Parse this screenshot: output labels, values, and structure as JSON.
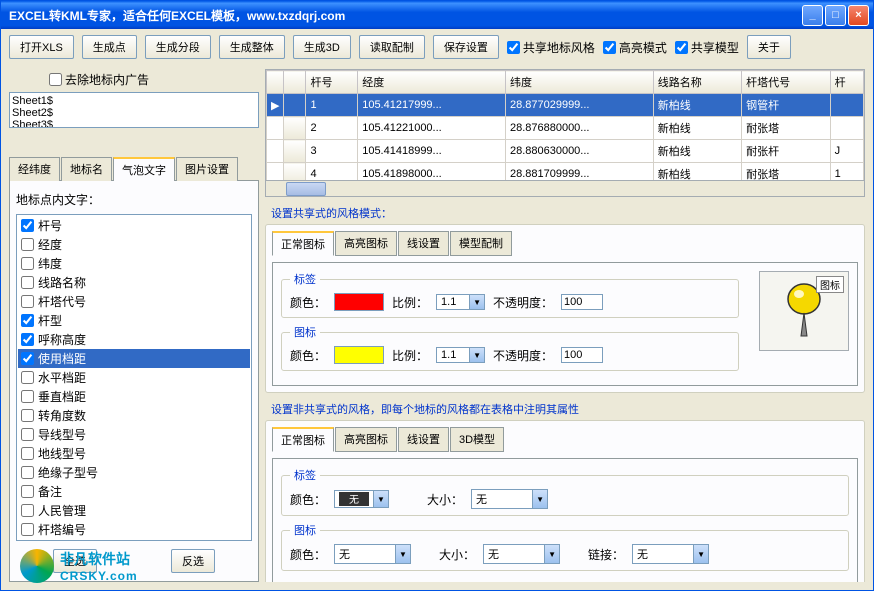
{
  "title": "EXCEL转KML专家，适合任何EXCEL模板，www.txzdqrj.com",
  "toolbar": {
    "open_xls": "打开XLS",
    "gen_points": "生成点",
    "gen_segments": "生成分段",
    "gen_whole": "生成整体",
    "gen_3d": "生成3D",
    "read_config": "读取配制",
    "save_settings": "保存设置",
    "share_landmark": "共享地标风格",
    "highlight_mode": "高亮模式",
    "share_model": "共享模型",
    "about": "关于"
  },
  "left": {
    "remove_ad": "去除地标内广告",
    "sheets": [
      "Sheet1$",
      "Sheet2$",
      "Sheet3$"
    ],
    "tabs": [
      "经纬度",
      "地标名",
      "气泡文字",
      "图片设置"
    ],
    "active_tab": 2,
    "point_text_label": "地标点内文字：",
    "checks": [
      {
        "label": "杆号",
        "checked": true
      },
      {
        "label": "经度",
        "checked": false
      },
      {
        "label": "纬度",
        "checked": false
      },
      {
        "label": "线路名称",
        "checked": false
      },
      {
        "label": "杆塔代号",
        "checked": false
      },
      {
        "label": "杆型",
        "checked": true
      },
      {
        "label": "呼称高度",
        "checked": true
      },
      {
        "label": "使用档距",
        "checked": true,
        "selected": true
      },
      {
        "label": "水平档距",
        "checked": false
      },
      {
        "label": "垂直档距",
        "checked": false
      },
      {
        "label": "转角度数",
        "checked": false
      },
      {
        "label": "导线型号",
        "checked": false
      },
      {
        "label": "地线型号",
        "checked": false
      },
      {
        "label": "绝缘子型号",
        "checked": false
      },
      {
        "label": "备注",
        "checked": false
      },
      {
        "label": "人民管理",
        "checked": false
      },
      {
        "label": "杆塔编号",
        "checked": false
      }
    ],
    "select_all": "全选",
    "invert": "反选"
  },
  "grid": {
    "headers": [
      "杆号",
      "经度",
      "纬度",
      "线路名称",
      "杆塔代号",
      "杆"
    ],
    "rows": [
      {
        "n": "1",
        "lng": "105.41217999...",
        "lat": "28.877029999...",
        "line": "新柏线",
        "code": "钢管杆",
        "t": ""
      },
      {
        "n": "2",
        "lng": "105.41221000...",
        "lat": "28.876880000...",
        "line": "新柏线",
        "code": "耐张塔",
        "t": ""
      },
      {
        "n": "3",
        "lng": "105.41418999...",
        "lat": "28.880630000...",
        "line": "新柏线",
        "code": "耐张杆",
        "t": "J"
      },
      {
        "n": "4",
        "lng": "105.41898000...",
        "lat": "28.881709999...",
        "line": "新柏线",
        "code": "耐张塔",
        "t": "1"
      }
    ]
  },
  "shared": {
    "title": "设置共享式的风格模式：",
    "tabs": [
      "正常图标",
      "高亮图标",
      "线设置",
      "模型配制"
    ],
    "label_group": "标签",
    "icon_group": "图标",
    "color": "颜色：",
    "ratio": "比例：",
    "opacity": "不透明度：",
    "ratio_val": "1.1",
    "opacity_val": "100",
    "pin_label": "图标"
  },
  "nonshared": {
    "title": "设置非共享式的风格，即每个地标的风格都在表格中注明其属性",
    "tabs": [
      "正常图标",
      "高亮图标",
      "线设置",
      "3D模型"
    ],
    "label_group": "标签",
    "icon_group": "图标",
    "color": "颜色：",
    "size": "大小：",
    "link": "链接：",
    "none": "无",
    "none_swatch": "无"
  },
  "logo": {
    "text1": "非凡软件站",
    "text2": "CRSKY.com"
  }
}
